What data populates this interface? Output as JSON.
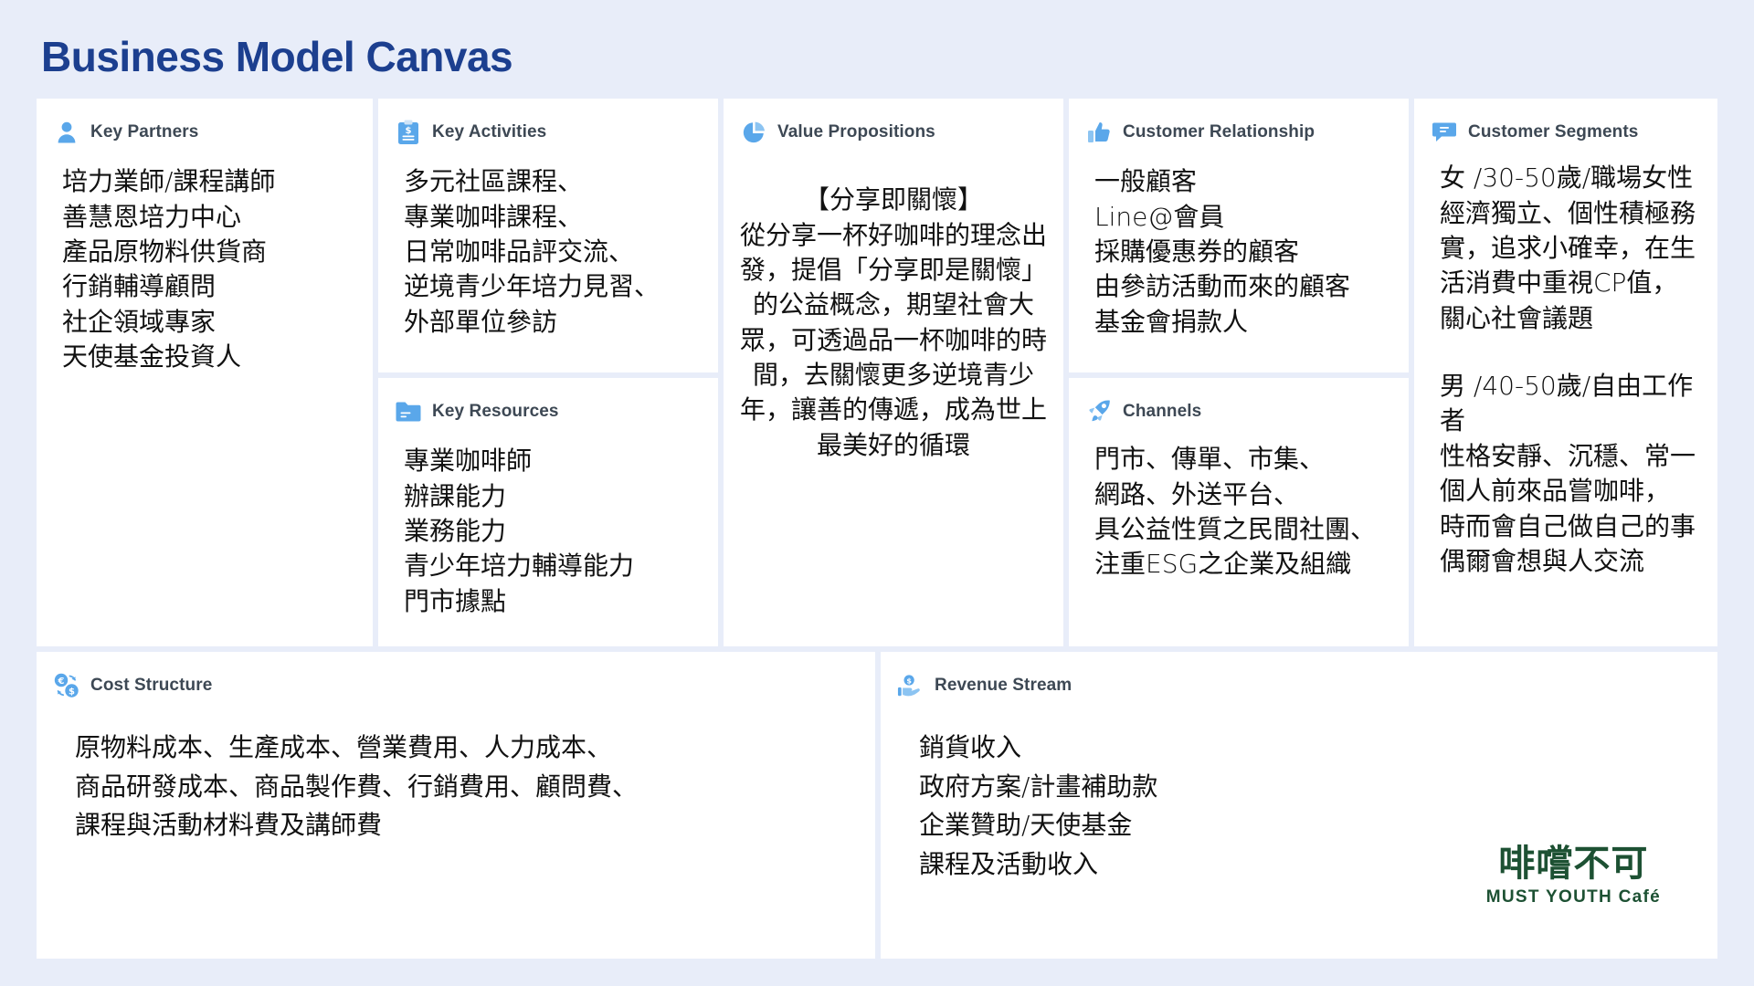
{
  "page": {
    "title": "Business Model Canvas",
    "background_color": "#e8edf9",
    "title_color": "#1c3f8f",
    "icon_color": "#5aa7ea",
    "header_text_color": "#3d4854"
  },
  "blocks": {
    "key_partners": {
      "title": "Key Partners",
      "icon": "person-icon",
      "body": "培力業師/課程講師\n善慧恩培力中心\n產品原物料供貨商\n行銷輔導顧問\n社企領域專家\n天使基金投資人"
    },
    "key_activities": {
      "title": "Key Activities",
      "icon": "clipboard-money-icon",
      "body": "多元社區課程、\n專業咖啡課程、\n日常咖啡品評交流、\n逆境青少年培力見習、\n外部單位參訪"
    },
    "key_resources": {
      "title": "Key Resources",
      "icon": "folder-icon",
      "body": "專業咖啡師\n辦課能力\n業務能力\n青少年培力輔導能力\n門市據點"
    },
    "value_propositions": {
      "title": "Value Propositions",
      "icon": "pie-chart-icon",
      "body": "【分享即關懷】\n從分享一杯好咖啡的理念出發，提倡「分享即是關懷」的公益概念，期望社會大眾，可透過品一杯咖啡的時間，去關懷更多逆境青少年，讓善的傳遞，成為世上最美好的循環"
    },
    "customer_relationship": {
      "title": "Customer Relationship",
      "icon": "thumbs-up-icon",
      "body": "一般顧客\nLine@會員\n採購優惠券的顧客\n由參訪活動而來的顧客\n基金會捐款人"
    },
    "channels": {
      "title": "Channels",
      "icon": "rocket-icon",
      "body": "門市、傳單、市集、\n網路、外送平台、\n具公益性質之民間社團、\n注重ESG之企業及組織"
    },
    "customer_segments": {
      "title": "Customer Segments",
      "icon": "speech-bubble-icon",
      "body_1": "女 /30-50歲/職場女性\n經濟獨立、個性積極務實，追求小確幸，在生活消費中重視CP值，關心社會議題",
      "body_2": "男 /40-50歲/自由工作者\n性格安靜、沉穩、常一個人前來品嘗咖啡，\n時而會自己做自己的事\n偶爾會想與人交流"
    },
    "cost_structure": {
      "title": "Cost Structure",
      "icon": "currency-exchange-icon",
      "body": "原物料成本、生產成本、營業費用、人力成本、\n商品研發成本、商品製作費、行銷費用、顧問費、\n課程與活動材料費及講師費"
    },
    "revenue_stream": {
      "title": "Revenue Stream",
      "icon": "hand-coin-icon",
      "body": "銷貨收入\n政府方案/計畫補助款\n企業贊助/天使基金\n課程及活動收入"
    }
  },
  "logo": {
    "mark": "啡嚐不可",
    "sub": "MUST YOUTH Café",
    "color": "#1d5133"
  }
}
